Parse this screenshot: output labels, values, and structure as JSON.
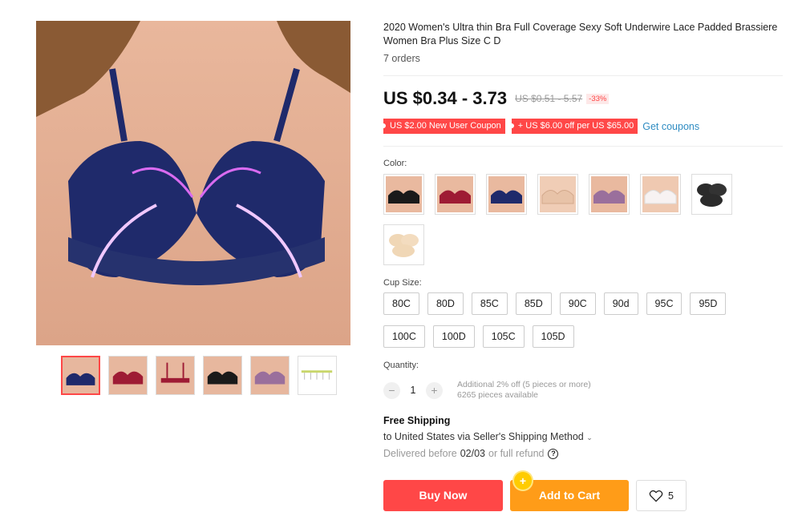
{
  "product": {
    "title": "2020 Women's Ultra thin Bra Full Coverage Sexy Soft Underwire Lace Padded Brassiere Women Bra Plus Size C D",
    "orders": "7 orders"
  },
  "price": {
    "current": "US $0.34 - 3.73",
    "original": "US $0.51 - 5.57",
    "discount": "-33%"
  },
  "coupons": {
    "new_user": "US $2.00 New User Coupon",
    "store": "+ US $6.00 off per US $65.00",
    "get_link": "Get coupons"
  },
  "color": {
    "label": "Color:",
    "options": [
      {
        "name": "black",
        "hex": "#1a1a1a"
      },
      {
        "name": "wine-red",
        "hex": "#9e1b34"
      },
      {
        "name": "navy-blue",
        "hex": "#1f2a6b"
      },
      {
        "name": "nude",
        "hex": "#e8c3a8"
      },
      {
        "name": "purple",
        "hex": "#9a6f9c"
      },
      {
        "name": "white",
        "hex": "#f3eeee"
      },
      {
        "name": "black-pads",
        "hex": "#2b2b2b"
      },
      {
        "name": "nude-pads",
        "hex": "#f0d7b6"
      }
    ]
  },
  "cup_size": {
    "label": "Cup Size:",
    "options": [
      "80C",
      "80D",
      "85C",
      "85D",
      "90C",
      "90d",
      "95C",
      "95D",
      "100C",
      "100D",
      "105C",
      "105D"
    ]
  },
  "quantity": {
    "label": "Quantity:",
    "minus": "−",
    "value": "1",
    "plus": "+",
    "discount_note": "Additional 2% off (5 pieces or more)",
    "available": "6265 pieces available"
  },
  "shipping": {
    "title": "Free Shipping",
    "line": "to United States via Seller's Shipping Method",
    "chevron": "⌄",
    "delivered_prefix": "Delivered before",
    "delivered_date": "02/03",
    "delivered_suffix": "or full refund",
    "help": "?"
  },
  "actions": {
    "buy_now": "Buy Now",
    "add_to_cart": "Add to Cart",
    "wishlist_count": "5"
  },
  "colors": {
    "accent_red": "#ff4747",
    "accent_orange": "#ff9c18",
    "link_blue": "#2f8cc2"
  }
}
